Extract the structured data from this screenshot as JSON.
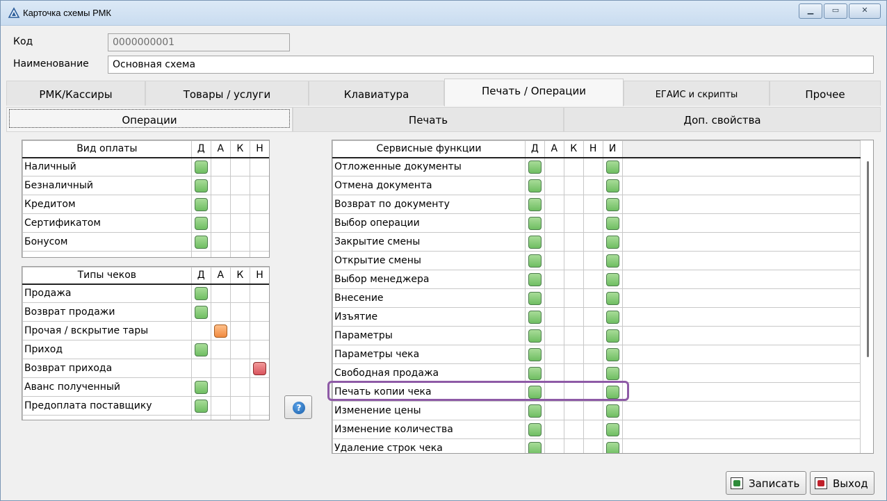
{
  "window": {
    "title": "Карточка схемы РМК"
  },
  "form": {
    "code_label": "Код",
    "code_value": "0000000001",
    "name_label": "Наименование",
    "name_value": "Основная схема"
  },
  "main_tabs": [
    {
      "label": "РМК/Кассиры"
    },
    {
      "label": "Товары / услуги"
    },
    {
      "label": "Клавиатура"
    },
    {
      "label": "Печать / Операции"
    },
    {
      "label": "ЕГАИС и скрипты"
    },
    {
      "label": "Прочее"
    }
  ],
  "sub_tabs": [
    {
      "label": "Операции"
    },
    {
      "label": "Печать"
    },
    {
      "label": "Доп. свойства"
    }
  ],
  "payment_table": {
    "headers": [
      "Вид оплаты",
      "Д",
      "А",
      "К",
      "Н"
    ],
    "rows": [
      {
        "name": "Наличный",
        "marks": [
          "green",
          "",
          "",
          ""
        ]
      },
      {
        "name": "Безналичный",
        "marks": [
          "green",
          "",
          "",
          ""
        ]
      },
      {
        "name": "Кредитом",
        "marks": [
          "green",
          "",
          "",
          ""
        ]
      },
      {
        "name": "Сертификатом",
        "marks": [
          "green",
          "",
          "",
          ""
        ]
      },
      {
        "name": "Бонусом",
        "marks": [
          "green",
          "",
          "",
          ""
        ]
      }
    ]
  },
  "receipt_table": {
    "headers": [
      "Типы чеков",
      "Д",
      "А",
      "К",
      "Н"
    ],
    "rows": [
      {
        "name": "Продажа",
        "marks": [
          "green",
          "",
          "",
          ""
        ]
      },
      {
        "name": "Возврат продажи",
        "marks": [
          "green",
          "",
          "",
          ""
        ]
      },
      {
        "name": "Прочая / вскрытие тары",
        "marks": [
          "",
          "orange",
          "",
          ""
        ]
      },
      {
        "name": "Приход",
        "marks": [
          "green",
          "",
          "",
          ""
        ]
      },
      {
        "name": "Возврат прихода",
        "marks": [
          "",
          "",
          "",
          "red"
        ]
      },
      {
        "name": "Аванс полученный",
        "marks": [
          "green",
          "",
          "",
          ""
        ]
      },
      {
        "name": "Предоплата поставщику",
        "marks": [
          "green",
          "",
          "",
          ""
        ]
      }
    ]
  },
  "service_table": {
    "headers": [
      "Сервисные функции",
      "Д",
      "А",
      "К",
      "Н",
      "И"
    ],
    "rows": [
      {
        "name": "Отложенные документы",
        "marks": [
          "green",
          "",
          "",
          "",
          "green"
        ]
      },
      {
        "name": "Отмена документа",
        "marks": [
          "green",
          "",
          "",
          "",
          "green"
        ]
      },
      {
        "name": "Возврат по документу",
        "marks": [
          "green",
          "",
          "",
          "",
          "green"
        ]
      },
      {
        "name": "Выбор операции",
        "marks": [
          "green",
          "",
          "",
          "",
          "green"
        ]
      },
      {
        "name": "Закрытие смены",
        "marks": [
          "green",
          "",
          "",
          "",
          "green"
        ]
      },
      {
        "name": "Открытие смены",
        "marks": [
          "green",
          "",
          "",
          "",
          "green"
        ]
      },
      {
        "name": "Выбор менеджера",
        "marks": [
          "green",
          "",
          "",
          "",
          "green"
        ]
      },
      {
        "name": "Внесение",
        "marks": [
          "green",
          "",
          "",
          "",
          "green"
        ]
      },
      {
        "name": "Изъятие",
        "marks": [
          "green",
          "",
          "",
          "",
          "green"
        ]
      },
      {
        "name": "Параметры",
        "marks": [
          "green",
          "",
          "",
          "",
          "green"
        ]
      },
      {
        "name": "Параметры чека",
        "marks": [
          "green",
          "",
          "",
          "",
          "green"
        ]
      },
      {
        "name": "Свободная продажа",
        "marks": [
          "green",
          "",
          "",
          "",
          "green"
        ]
      },
      {
        "name": "Печать копии чека",
        "marks": [
          "green",
          "",
          "",
          "",
          "green"
        ]
      },
      {
        "name": "Изменение цены",
        "marks": [
          "green",
          "",
          "",
          "",
          "green"
        ]
      },
      {
        "name": "Изменение количества",
        "marks": [
          "green",
          "",
          "",
          "",
          "green"
        ]
      },
      {
        "name": "Удаление строк чека",
        "marks": [
          "green",
          "",
          "",
          "",
          "green"
        ]
      }
    ]
  },
  "help_button": {
    "glyph": "?"
  },
  "footer": {
    "save_label": "Записать",
    "exit_label": "Выход"
  },
  "colors": {
    "highlight": "#8e5aa6",
    "mark_green": "#7cc46e",
    "mark_orange": "#f59a50",
    "mark_red": "#e06068"
  }
}
